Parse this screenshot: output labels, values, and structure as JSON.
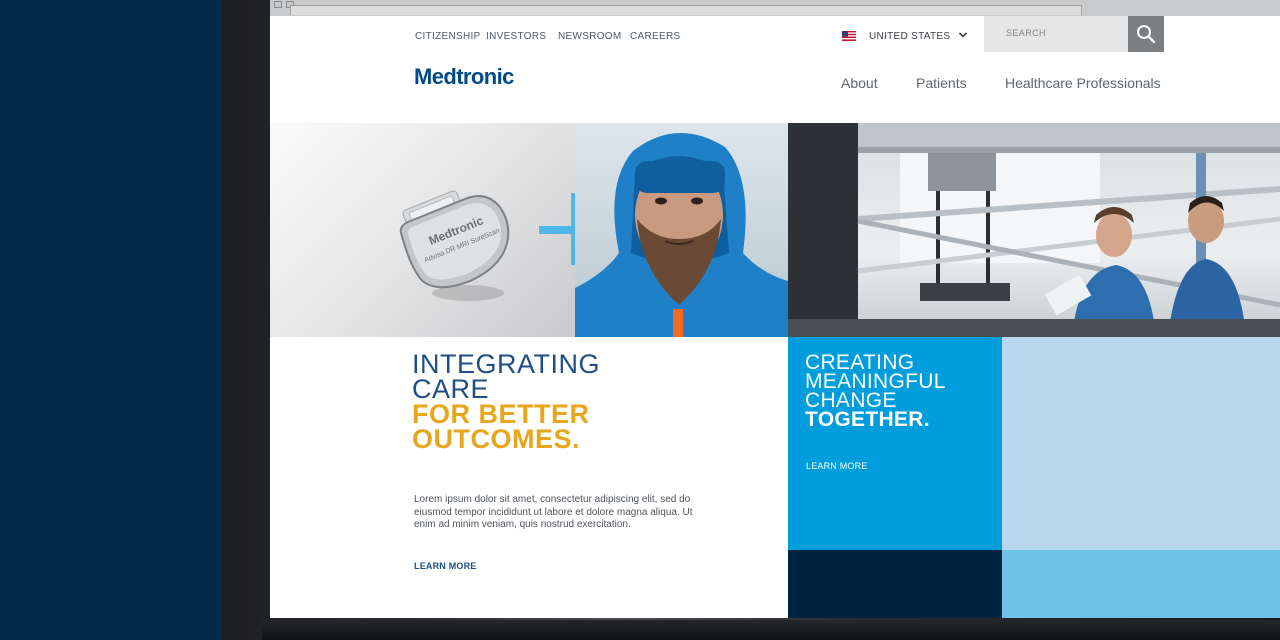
{
  "utility_nav": [
    "CITIZENSHIP",
    "INVESTORS",
    "NEWSROOM",
    "CAREERS"
  ],
  "region": {
    "label": "UNITED STATES",
    "flag_icon": "us-flag-icon"
  },
  "search": {
    "placeholder": "SEARCH",
    "icon": "search-icon"
  },
  "brand": {
    "logo_text": "Medtronic",
    "color": "#004b87"
  },
  "main_nav": [
    "About",
    "Patients",
    "Healthcare Professionals"
  ],
  "hero": {
    "device_text": "Medtronic",
    "device_model": "Advisa DR MRI SureScan"
  },
  "feature": {
    "heading_line1": "INTEGRATING",
    "heading_line2": "CARE",
    "heading_line3": "FOR BETTER",
    "heading_line4": "OUTCOMES.",
    "body": "Lorem ipsum dolor sit amet, consectetur adipiscing elit, sed do eiusmod tempor incididunt ut labore et dolore magna aliqua. Ut enim ad minim veniam, quis nostrud exercitation.",
    "cta": "LEARN MORE"
  },
  "tile": {
    "heading_line1": "CREATING",
    "heading_line2": "MEANINGFUL",
    "heading_line3": "CHANGE",
    "heading_line4": "TOGETHER.",
    "cta": "LEARN MORE"
  },
  "colors": {
    "background_navy": "#032a48",
    "accent_blue": "#009ddc",
    "light_blue": "#b9d7ed",
    "sky_blue": "#71c2e8",
    "dark_navy": "#00233f",
    "gold": "#e8a61c"
  }
}
